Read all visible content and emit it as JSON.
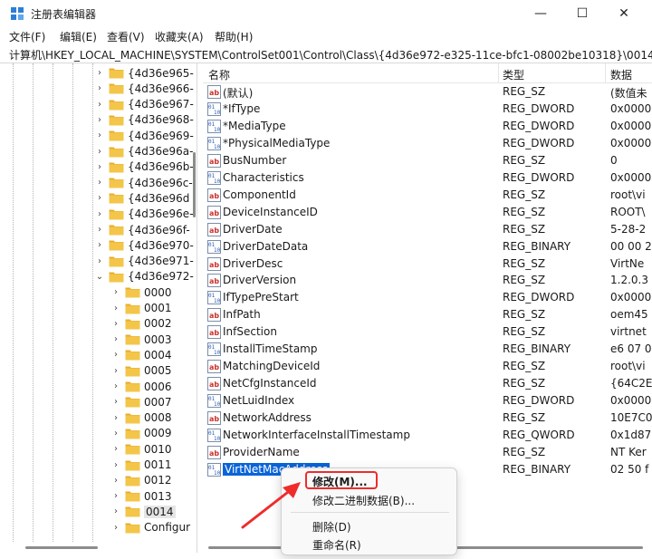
{
  "window": {
    "title": "注册表编辑器",
    "minimize": "—",
    "maximize": "☐",
    "close": "✕"
  },
  "menu": [
    "文件(F)",
    "编辑(E)",
    "查看(V)",
    "收藏夹(A)",
    "帮助(H)"
  ],
  "address": "计算机\\HKEY_LOCAL_MACHINE\\SYSTEM\\ControlSet001\\Control\\Class\\{4d36e972-e325-11ce-bfc1-08002be10318}\\0014",
  "tree": {
    "class_keys": [
      "{4d36e965-",
      "{4d36e966-",
      "{4d36e967-",
      "{4d36e968-",
      "{4d36e969-",
      "{4d36e96a-",
      "{4d36e96b-",
      "{4d36e96c-",
      "{4d36e96d",
      "{4d36e96e-",
      "{4d36e96f-",
      "{4d36e970-",
      "{4d36e971-",
      "{4d36e972-"
    ],
    "expanded_index": 13,
    "sub_keys": [
      "0000",
      "0001",
      "0002",
      "0003",
      "0004",
      "0005",
      "0006",
      "0007",
      "0008",
      "0009",
      "0010",
      "0011",
      "0012",
      "0013",
      "0014",
      "Configur"
    ],
    "selected_sub": "0014",
    "chevron_collapsed": "›",
    "chevron_expanded": "⌄"
  },
  "list": {
    "columns": [
      "名称",
      "类型",
      "数据"
    ],
    "rows": [
      {
        "name": "(默认)",
        "type": "REG_SZ",
        "data": "(数值未",
        "icon": "string-value-icon"
      },
      {
        "name": "*IfType",
        "type": "REG_DWORD",
        "data": "0x0000",
        "icon": "binary-value-icon"
      },
      {
        "name": "*MediaType",
        "type": "REG_DWORD",
        "data": "0x0000",
        "icon": "binary-value-icon"
      },
      {
        "name": "*PhysicalMediaType",
        "type": "REG_DWORD",
        "data": "0x0000",
        "icon": "binary-value-icon"
      },
      {
        "name": "BusNumber",
        "type": "REG_SZ",
        "data": "0",
        "icon": "string-value-icon"
      },
      {
        "name": "Characteristics",
        "type": "REG_DWORD",
        "data": "0x0000",
        "icon": "binary-value-icon"
      },
      {
        "name": "ComponentId",
        "type": "REG_SZ",
        "data": "root\\vi",
        "icon": "string-value-icon"
      },
      {
        "name": "DeviceInstanceID",
        "type": "REG_SZ",
        "data": "ROOT\\",
        "icon": "string-value-icon"
      },
      {
        "name": "DriverDate",
        "type": "REG_SZ",
        "data": "5-28-2",
        "icon": "string-value-icon"
      },
      {
        "name": "DriverDateData",
        "type": "REG_BINARY",
        "data": "00 00 2",
        "icon": "binary-value-icon"
      },
      {
        "name": "DriverDesc",
        "type": "REG_SZ",
        "data": "VirtNe",
        "icon": "string-value-icon"
      },
      {
        "name": "DriverVersion",
        "type": "REG_SZ",
        "data": "1.2.0.3",
        "icon": "string-value-icon"
      },
      {
        "name": "IfTypePreStart",
        "type": "REG_DWORD",
        "data": "0x0000",
        "icon": "binary-value-icon"
      },
      {
        "name": "InfPath",
        "type": "REG_SZ",
        "data": "oem45",
        "icon": "string-value-icon"
      },
      {
        "name": "InfSection",
        "type": "REG_SZ",
        "data": "virtnet",
        "icon": "string-value-icon"
      },
      {
        "name": "InstallTimeStamp",
        "type": "REG_BINARY",
        "data": "e6 07 0",
        "icon": "binary-value-icon"
      },
      {
        "name": "MatchingDeviceId",
        "type": "REG_SZ",
        "data": "root\\vi",
        "icon": "string-value-icon"
      },
      {
        "name": "NetCfgInstanceId",
        "type": "REG_SZ",
        "data": "{64C2E",
        "icon": "string-value-icon"
      },
      {
        "name": "NetLuidIndex",
        "type": "REG_DWORD",
        "data": "0x0000",
        "icon": "binary-value-icon"
      },
      {
        "name": "NetworkAddress",
        "type": "REG_SZ",
        "data": "10E7C0",
        "icon": "string-value-icon"
      },
      {
        "name": "NetworkInterfaceInstallTimestamp",
        "type": "REG_QWORD",
        "data": "0x1d87",
        "icon": "binary-value-icon"
      },
      {
        "name": "ProviderName",
        "type": "REG_SZ",
        "data": "NT Ker",
        "icon": "string-value-icon"
      },
      {
        "name": "VirtNetMacAddress",
        "type": "REG_BINARY",
        "data": "02 50 f",
        "icon": "binary-value-icon"
      }
    ],
    "selected_index": 22
  },
  "context_menu": {
    "items": [
      "修改(M)...",
      "修改二进制数据(B)...",
      "删除(D)",
      "重命名(R)"
    ]
  },
  "colors": {
    "selection": "#0a64d8",
    "highlight_box": "#ee2c2c",
    "arrow": "#ee2c2c",
    "folder": "#f3c64a"
  }
}
